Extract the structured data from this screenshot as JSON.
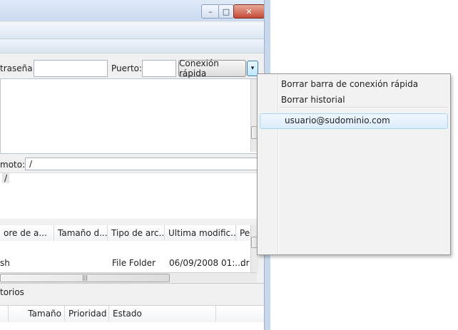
{
  "window": {
    "minimize": "–",
    "maximize": "□",
    "close": "✕"
  },
  "quickconnect": {
    "password_label": "traseña:",
    "password_value": "",
    "port_label": "Puerto:",
    "port_value": "",
    "connect_button": "Conexión rápida",
    "dropdown_glyph": "▾"
  },
  "remote": {
    "site_label": "moto:",
    "path_value": "/",
    "tree_item": "/"
  },
  "file_list": {
    "columns": [
      "ore de a...",
      "/",
      "Tamaño d...",
      "Tipo de arc...",
      "Ultima modific...",
      "Pe"
    ],
    "rows": [
      {
        "name": "sh",
        "size": "",
        "type": "File Folder",
        "modified": "06/09/2008 01:...",
        "perms": "dr"
      }
    ],
    "hscroll_grip": "|||"
  },
  "queue": {
    "tab_label": "torios",
    "columns": [
      "Tamaño",
      "Prioridad",
      "Estado"
    ]
  },
  "menu": {
    "items": [
      {
        "label": "Borrar barra de conexión rápida"
      },
      {
        "label": "Borrar historial"
      },
      {
        "label": "usuario@sudominio.com"
      }
    ]
  }
}
